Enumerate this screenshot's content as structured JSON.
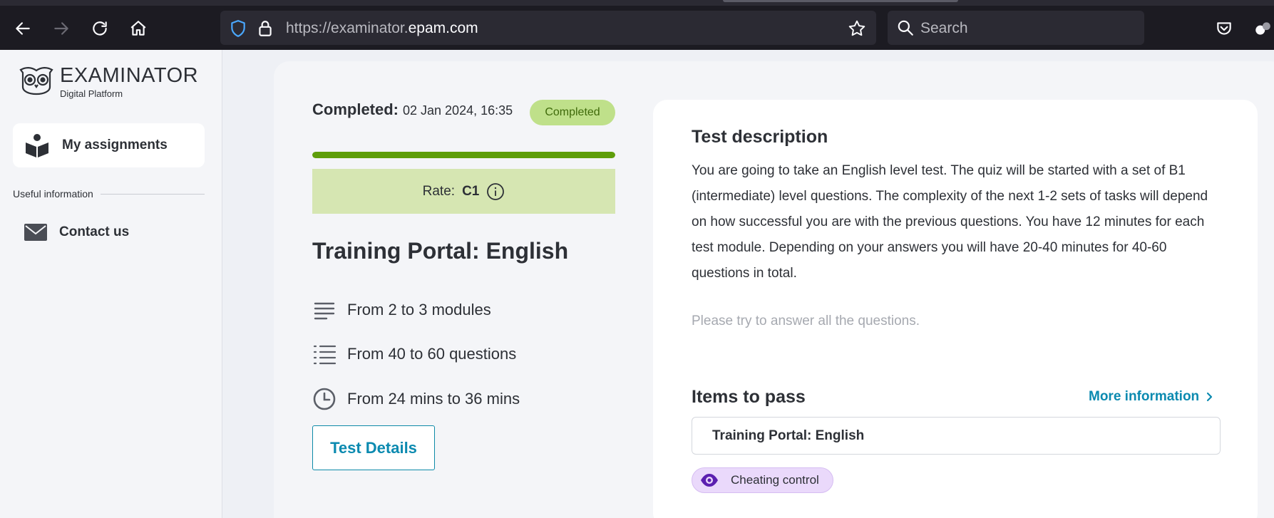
{
  "browser": {
    "url_scheme": "https://examinator.",
    "url_host": "epam.com",
    "search_placeholder": "Search"
  },
  "sidebar": {
    "logo_title": "EXAMINATOR",
    "logo_subtitle": "Digital Platform",
    "nav_my_assignments": "My assignments",
    "section_label": "Useful information",
    "nav_contact": "Contact us"
  },
  "summary": {
    "completed_label": "Completed:",
    "completed_date": "02 Jan 2024, 16:35",
    "status_badge": "Completed",
    "progress_fraction": 1.0,
    "rate_label": "Rate:",
    "rate_value": "C1",
    "test_title": "Training Portal: English",
    "modules": "From 2 to 3 modules",
    "questions": "From 40 to 60 questions",
    "duration": "From 24 mins to 36 mins",
    "details_button": "Test Details"
  },
  "description": {
    "title": "Test description",
    "body": "You are going to take an English level test. The quiz will be started with a set of B1 (intermediate) level questions. The complexity of the next 1-2 sets of tasks will depend on how successful you are with the previous questions. You have 12 minutes for each test module. Depending on your answers you will have 20-40 minutes for 40-60 questions in total.",
    "hint": "Please try to answer all the questions.",
    "items_title": "Items to pass",
    "more_info": "More information",
    "item_name": "Training Portal: English",
    "cheating_badge": "Cheating control"
  },
  "colors": {
    "accent": "#0b8ab0",
    "success_bar": "#5f9e0b",
    "rate_bg": "#d6e6b2",
    "badge_bg": "#bfe08a",
    "cheat_bg": "#ead9fb"
  }
}
